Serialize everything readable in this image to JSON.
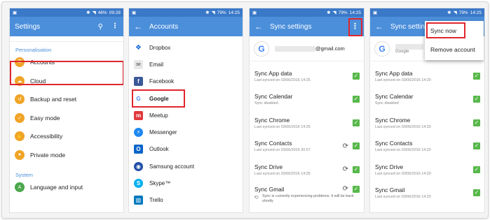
{
  "status": {
    "s1": {
      "battery": "46%",
      "time": "09:28"
    },
    "s2": {
      "battery": "79%",
      "time": "14:25"
    },
    "s3": {
      "battery": "79%",
      "time": "14:25"
    },
    "s4": {
      "battery": "79%",
      "time": "14:25"
    }
  },
  "settings": {
    "title": "Settings",
    "personalisation_label": "Personalisation",
    "items": [
      {
        "label": "Accounts",
        "icon": "key-icon"
      },
      {
        "label": "Cloud",
        "icon": "cloud-icon"
      },
      {
        "label": "Backup and reset",
        "icon": "backup-icon"
      },
      {
        "label": "Easy mode",
        "icon": "easy-mode-icon"
      },
      {
        "label": "Accessibility",
        "icon": "accessibility-icon"
      },
      {
        "label": "Private mode",
        "icon": "private-mode-icon"
      }
    ],
    "system_label": "System",
    "system_items": [
      {
        "label": "Language and input",
        "icon": "language-icon"
      }
    ]
  },
  "accounts": {
    "title": "Accounts",
    "items": [
      {
        "label": "Dropbox",
        "icon": "dropbox-icon"
      },
      {
        "label": "Email",
        "icon": "email-icon"
      },
      {
        "label": "Facebook",
        "icon": "facebook-icon"
      },
      {
        "label": "Google",
        "icon": "google-icon"
      },
      {
        "label": "Meetup",
        "icon": "meetup-icon"
      },
      {
        "label": "Messenger",
        "icon": "messenger-icon"
      },
      {
        "label": "Outlook",
        "icon": "outlook-icon"
      },
      {
        "label": "Samsung account",
        "icon": "samsung-icon"
      },
      {
        "label": "Skype™",
        "icon": "skype-icon"
      },
      {
        "label": "Trello",
        "icon": "trello-icon"
      }
    ]
  },
  "sync": {
    "title": "Sync settings",
    "email_suffix": "@gmail.com",
    "account_sub": "Google",
    "items": [
      {
        "name": "Sync App data",
        "sub": "Last synced on 03/06/2016 14:25"
      },
      {
        "name": "Sync Calendar",
        "sub": "Sync disabled"
      },
      {
        "name": "Sync Chrome",
        "sub": "Last synced on 03/06/2016 14:25"
      },
      {
        "name": "Sync Contacts",
        "sub": "Last synced on 03/06/2016 20:57"
      },
      {
        "name": "Sync Drive",
        "sub": "Last synced on 03/06/2016 14:25"
      },
      {
        "name": "Sync Gmail",
        "sub": ""
      }
    ],
    "warning": "Sync is currently experiencing problems. It will be back shortly"
  },
  "sync4": {
    "title": "Sync settings",
    "items": [
      {
        "name": "Sync App data",
        "sub": "Last synced on 03/06/2016 14:20"
      },
      {
        "name": "Sync Calendar",
        "sub": "Sync disabled"
      },
      {
        "name": "Sync Chrome",
        "sub": "Last synced on 03/06/2016 14:20"
      },
      {
        "name": "Sync Contacts",
        "sub": "Last synced on 03/06/2016 14:20"
      },
      {
        "name": "Sync Drive",
        "sub": "Last synced on 03/06/2016 14:20"
      },
      {
        "name": "Sync Gmail",
        "sub": "Last synced on 03/06/2016 14:20"
      }
    ],
    "menu": {
      "sync_now": "Sync now",
      "remove_account": "Remove account"
    }
  },
  "colors": {
    "accent": "#4b8fdb",
    "highlight": "#e0262d",
    "check": "#58b84b",
    "settings_icon": "#f0a427"
  }
}
